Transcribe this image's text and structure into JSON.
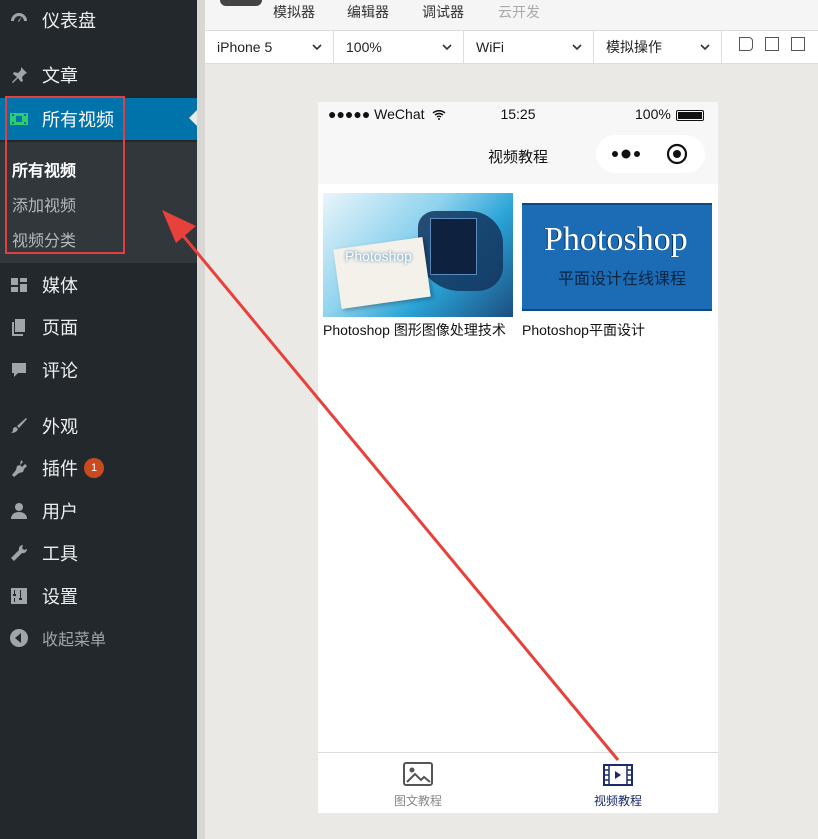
{
  "sidebar": {
    "items": [
      {
        "label": "仪表盘",
        "icon": "dashboard-icon"
      },
      {
        "label": "文章",
        "icon": "pin-icon"
      },
      {
        "label": "所有视频",
        "icon": "video-icon"
      },
      {
        "label": "媒体",
        "icon": "media-icon"
      },
      {
        "label": "页面",
        "icon": "pages-icon"
      },
      {
        "label": "评论",
        "icon": "comment-icon"
      },
      {
        "label": "外观",
        "icon": "brush-icon"
      },
      {
        "label": "插件",
        "icon": "plugin-icon"
      },
      {
        "label": "用户",
        "icon": "user-icon"
      },
      {
        "label": "工具",
        "icon": "wrench-icon"
      },
      {
        "label": "设置",
        "icon": "settings-icon"
      }
    ],
    "plugin_badge": "1",
    "submenu": [
      "所有视频",
      "添加视频",
      "视频分类"
    ],
    "collapse_label": "收起菜单",
    "accent_color": "#0073aa",
    "highlight_color": "#e04040"
  },
  "devtools": {
    "tabs": [
      "模拟器",
      "编辑器",
      "调试器",
      "云开发"
    ],
    "device": "iPhone 5",
    "zoom": "100%",
    "network": "WiFi",
    "operation": "模拟操作"
  },
  "phone": {
    "status_left": "●●●●● WeChat",
    "time": "15:25",
    "battery": "100%",
    "nav_title": "视频教程",
    "videos": [
      {
        "title": "Photoshop 图形图像处理技术",
        "thumb_text": "Photoshop"
      },
      {
        "title": "Photoshop平面设计",
        "thumb_text": "Photoshop",
        "thumb_sub": "平面设计在线课程"
      }
    ],
    "tabs": [
      {
        "label": "图文教程",
        "icon": "image-icon",
        "active": false
      },
      {
        "label": "视频教程",
        "icon": "video-icon",
        "active": true
      }
    ],
    "active_tab_color": "#1a2a6c"
  }
}
